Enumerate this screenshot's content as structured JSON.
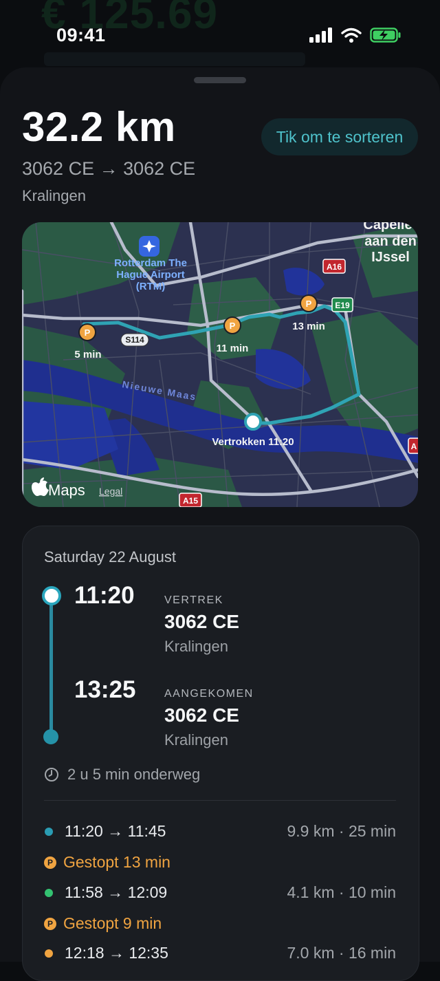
{
  "background_header": {
    "faded_value": "€ 125.69"
  },
  "status_bar": {
    "time": "09:41"
  },
  "summary": {
    "distance": "32.2 km",
    "route": "3062 CE → 3062 CE",
    "area": "Kralingen",
    "sort_button": "Tik om te sorteren"
  },
  "map": {
    "airport_label": "Rotterdam The Hague Airport (RTM)",
    "city_label": "Capelle aan den IJssel",
    "water_label": "Nieuwe Maas",
    "road_s114": "S114",
    "road_a16": "A16",
    "road_e19": "E19",
    "road_a15": "A15",
    "road_a": "A",
    "stop_5": "5 min",
    "stop_11": "11 min",
    "stop_13": "13 min",
    "parking_glyph": "P",
    "departed": "Vertrokken 11:20",
    "maps_brand": "Maps",
    "legal": "Legal"
  },
  "trip": {
    "date": "Saturday 22 August",
    "depart": {
      "time": "11:20",
      "caption": "VERTREK",
      "postcode": "3062 CE",
      "town": "Kralingen"
    },
    "arrive": {
      "time": "13:25",
      "caption": "AANGEKOMEN",
      "postcode": "3062 CE",
      "town": "Kralingen"
    },
    "duration": "2 u 5 min onderweg"
  },
  "segments": [
    {
      "times": "11:20 → 11:45",
      "meta": "9.9 km · 25 min",
      "color": "#2a9cb3"
    },
    {
      "stop": "Gestopt 13 min"
    },
    {
      "times": "11:58 → 12:09",
      "meta": "4.1 km · 10 min",
      "color": "#33c271"
    },
    {
      "stop": "Gestopt 9 min"
    },
    {
      "times": "12:18 → 12:35",
      "meta": "7.0 km · 16 min",
      "color": "#f0a441"
    }
  ],
  "colors": {
    "accent": "#2aa6bd",
    "parking": "#f0a441",
    "route_line": "#2fa3b4"
  }
}
